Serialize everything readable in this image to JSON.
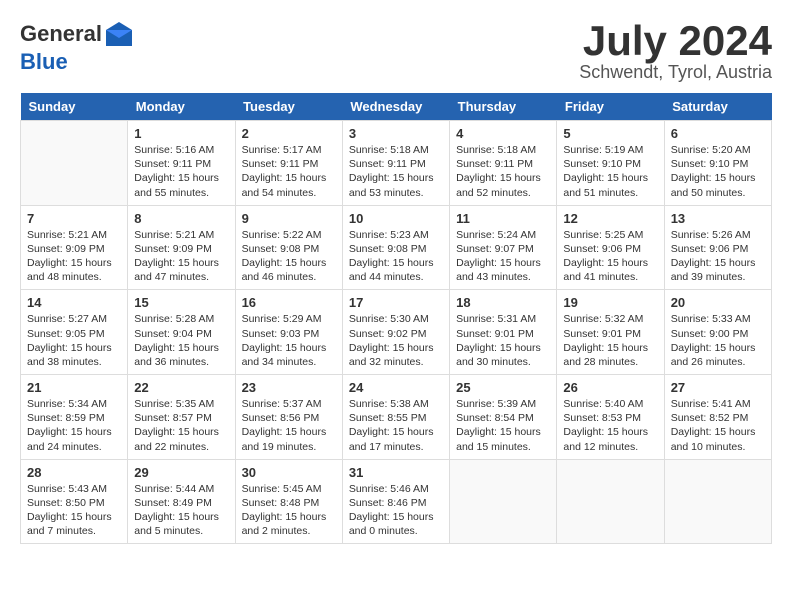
{
  "header": {
    "logo_general": "General",
    "logo_blue": "Blue",
    "month_title": "July 2024",
    "location": "Schwendt, Tyrol, Austria"
  },
  "columns": [
    "Sunday",
    "Monday",
    "Tuesday",
    "Wednesday",
    "Thursday",
    "Friday",
    "Saturday"
  ],
  "weeks": [
    [
      {
        "day": "",
        "empty": true
      },
      {
        "day": "1",
        "sunrise": "Sunrise: 5:16 AM",
        "sunset": "Sunset: 9:11 PM",
        "daylight": "Daylight: 15 hours and 55 minutes."
      },
      {
        "day": "2",
        "sunrise": "Sunrise: 5:17 AM",
        "sunset": "Sunset: 9:11 PM",
        "daylight": "Daylight: 15 hours and 54 minutes."
      },
      {
        "day": "3",
        "sunrise": "Sunrise: 5:18 AM",
        "sunset": "Sunset: 9:11 PM",
        "daylight": "Daylight: 15 hours and 53 minutes."
      },
      {
        "day": "4",
        "sunrise": "Sunrise: 5:18 AM",
        "sunset": "Sunset: 9:11 PM",
        "daylight": "Daylight: 15 hours and 52 minutes."
      },
      {
        "day": "5",
        "sunrise": "Sunrise: 5:19 AM",
        "sunset": "Sunset: 9:10 PM",
        "daylight": "Daylight: 15 hours and 51 minutes."
      },
      {
        "day": "6",
        "sunrise": "Sunrise: 5:20 AM",
        "sunset": "Sunset: 9:10 PM",
        "daylight": "Daylight: 15 hours and 50 minutes."
      }
    ],
    [
      {
        "day": "7",
        "sunrise": "Sunrise: 5:21 AM",
        "sunset": "Sunset: 9:09 PM",
        "daylight": "Daylight: 15 hours and 48 minutes."
      },
      {
        "day": "8",
        "sunrise": "Sunrise: 5:21 AM",
        "sunset": "Sunset: 9:09 PM",
        "daylight": "Daylight: 15 hours and 47 minutes."
      },
      {
        "day": "9",
        "sunrise": "Sunrise: 5:22 AM",
        "sunset": "Sunset: 9:08 PM",
        "daylight": "Daylight: 15 hours and 46 minutes."
      },
      {
        "day": "10",
        "sunrise": "Sunrise: 5:23 AM",
        "sunset": "Sunset: 9:08 PM",
        "daylight": "Daylight: 15 hours and 44 minutes."
      },
      {
        "day": "11",
        "sunrise": "Sunrise: 5:24 AM",
        "sunset": "Sunset: 9:07 PM",
        "daylight": "Daylight: 15 hours and 43 minutes."
      },
      {
        "day": "12",
        "sunrise": "Sunrise: 5:25 AM",
        "sunset": "Sunset: 9:06 PM",
        "daylight": "Daylight: 15 hours and 41 minutes."
      },
      {
        "day": "13",
        "sunrise": "Sunrise: 5:26 AM",
        "sunset": "Sunset: 9:06 PM",
        "daylight": "Daylight: 15 hours and 39 minutes."
      }
    ],
    [
      {
        "day": "14",
        "sunrise": "Sunrise: 5:27 AM",
        "sunset": "Sunset: 9:05 PM",
        "daylight": "Daylight: 15 hours and 38 minutes."
      },
      {
        "day": "15",
        "sunrise": "Sunrise: 5:28 AM",
        "sunset": "Sunset: 9:04 PM",
        "daylight": "Daylight: 15 hours and 36 minutes."
      },
      {
        "day": "16",
        "sunrise": "Sunrise: 5:29 AM",
        "sunset": "Sunset: 9:03 PM",
        "daylight": "Daylight: 15 hours and 34 minutes."
      },
      {
        "day": "17",
        "sunrise": "Sunrise: 5:30 AM",
        "sunset": "Sunset: 9:02 PM",
        "daylight": "Daylight: 15 hours and 32 minutes."
      },
      {
        "day": "18",
        "sunrise": "Sunrise: 5:31 AM",
        "sunset": "Sunset: 9:01 PM",
        "daylight": "Daylight: 15 hours and 30 minutes."
      },
      {
        "day": "19",
        "sunrise": "Sunrise: 5:32 AM",
        "sunset": "Sunset: 9:01 PM",
        "daylight": "Daylight: 15 hours and 28 minutes."
      },
      {
        "day": "20",
        "sunrise": "Sunrise: 5:33 AM",
        "sunset": "Sunset: 9:00 PM",
        "daylight": "Daylight: 15 hours and 26 minutes."
      }
    ],
    [
      {
        "day": "21",
        "sunrise": "Sunrise: 5:34 AM",
        "sunset": "Sunset: 8:59 PM",
        "daylight": "Daylight: 15 hours and 24 minutes."
      },
      {
        "day": "22",
        "sunrise": "Sunrise: 5:35 AM",
        "sunset": "Sunset: 8:57 PM",
        "daylight": "Daylight: 15 hours and 22 minutes."
      },
      {
        "day": "23",
        "sunrise": "Sunrise: 5:37 AM",
        "sunset": "Sunset: 8:56 PM",
        "daylight": "Daylight: 15 hours and 19 minutes."
      },
      {
        "day": "24",
        "sunrise": "Sunrise: 5:38 AM",
        "sunset": "Sunset: 8:55 PM",
        "daylight": "Daylight: 15 hours and 17 minutes."
      },
      {
        "day": "25",
        "sunrise": "Sunrise: 5:39 AM",
        "sunset": "Sunset: 8:54 PM",
        "daylight": "Daylight: 15 hours and 15 minutes."
      },
      {
        "day": "26",
        "sunrise": "Sunrise: 5:40 AM",
        "sunset": "Sunset: 8:53 PM",
        "daylight": "Daylight: 15 hours and 12 minutes."
      },
      {
        "day": "27",
        "sunrise": "Sunrise: 5:41 AM",
        "sunset": "Sunset: 8:52 PM",
        "daylight": "Daylight: 15 hours and 10 minutes."
      }
    ],
    [
      {
        "day": "28",
        "sunrise": "Sunrise: 5:43 AM",
        "sunset": "Sunset: 8:50 PM",
        "daylight": "Daylight: 15 hours and 7 minutes."
      },
      {
        "day": "29",
        "sunrise": "Sunrise: 5:44 AM",
        "sunset": "Sunset: 8:49 PM",
        "daylight": "Daylight: 15 hours and 5 minutes."
      },
      {
        "day": "30",
        "sunrise": "Sunrise: 5:45 AM",
        "sunset": "Sunset: 8:48 PM",
        "daylight": "Daylight: 15 hours and 2 minutes."
      },
      {
        "day": "31",
        "sunrise": "Sunrise: 5:46 AM",
        "sunset": "Sunset: 8:46 PM",
        "daylight": "Daylight: 15 hours and 0 minutes."
      },
      {
        "day": "",
        "empty": true
      },
      {
        "day": "",
        "empty": true
      },
      {
        "day": "",
        "empty": true
      }
    ]
  ]
}
